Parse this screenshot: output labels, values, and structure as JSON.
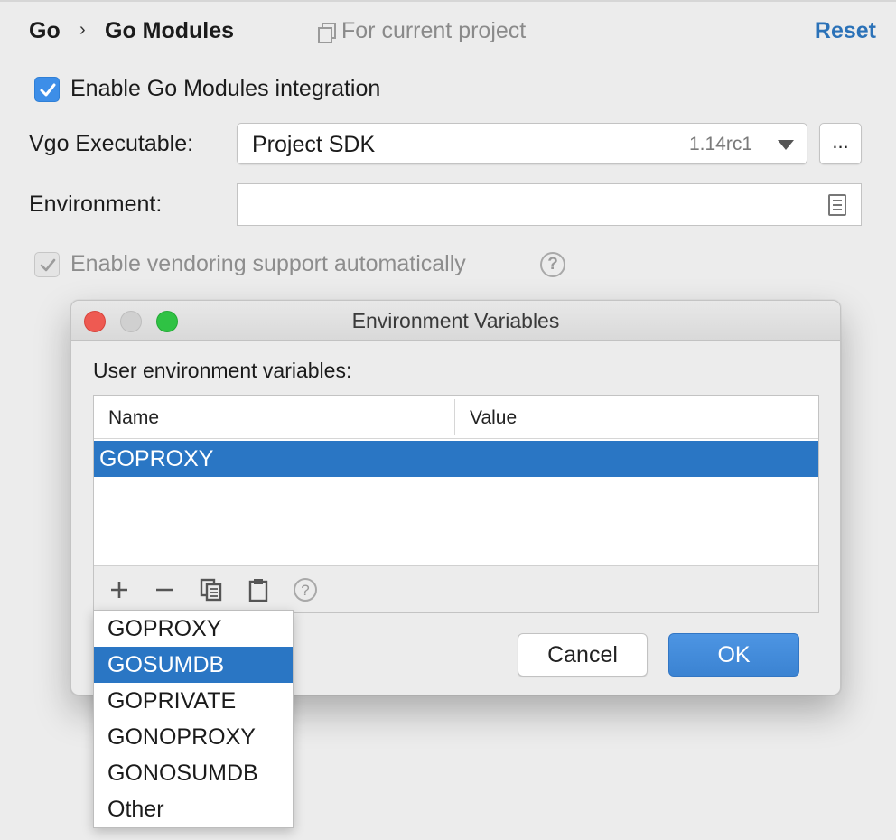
{
  "header": {
    "breadcrumb_parent": "Go",
    "breadcrumb_current": "Go Modules",
    "scope_label": "For current project",
    "reset_label": "Reset"
  },
  "settings": {
    "enable_modules_label": "Enable Go Modules integration",
    "enable_modules_checked": true,
    "vgo_label": "Vgo Executable:",
    "vgo_value": "Project SDK",
    "vgo_version": "1.14rc1",
    "browse_label": "...",
    "environment_label": "Environment:",
    "environment_value": "",
    "vendoring_label": "Enable vendoring support automatically",
    "vendoring_checked": true,
    "vendoring_enabled": false
  },
  "dialog": {
    "title": "Environment Variables",
    "section_label": "User environment variables:",
    "columns": [
      "Name",
      "Value"
    ],
    "rows": [
      {
        "name": "GOPROXY",
        "value": ""
      }
    ],
    "toolbar_icons": [
      "add-icon",
      "remove-icon",
      "copy-icon",
      "paste-icon",
      "help-icon"
    ],
    "cancel_label": "Cancel",
    "ok_label": "OK"
  },
  "popup": {
    "items": [
      "GOPROXY",
      "GOSUMDB",
      "GOPRIVATE",
      "GONOPROXY",
      "GONOSUMDB",
      "Other"
    ],
    "selected_index": 1
  },
  "colors": {
    "accent": "#2b72b8",
    "selection": "#2a76c4",
    "checkbox": "#3d8ee8",
    "close_light": "#ee5a52",
    "minimize_light_inactive": "#d0d0d0",
    "zoom_light": "#2fc244"
  }
}
